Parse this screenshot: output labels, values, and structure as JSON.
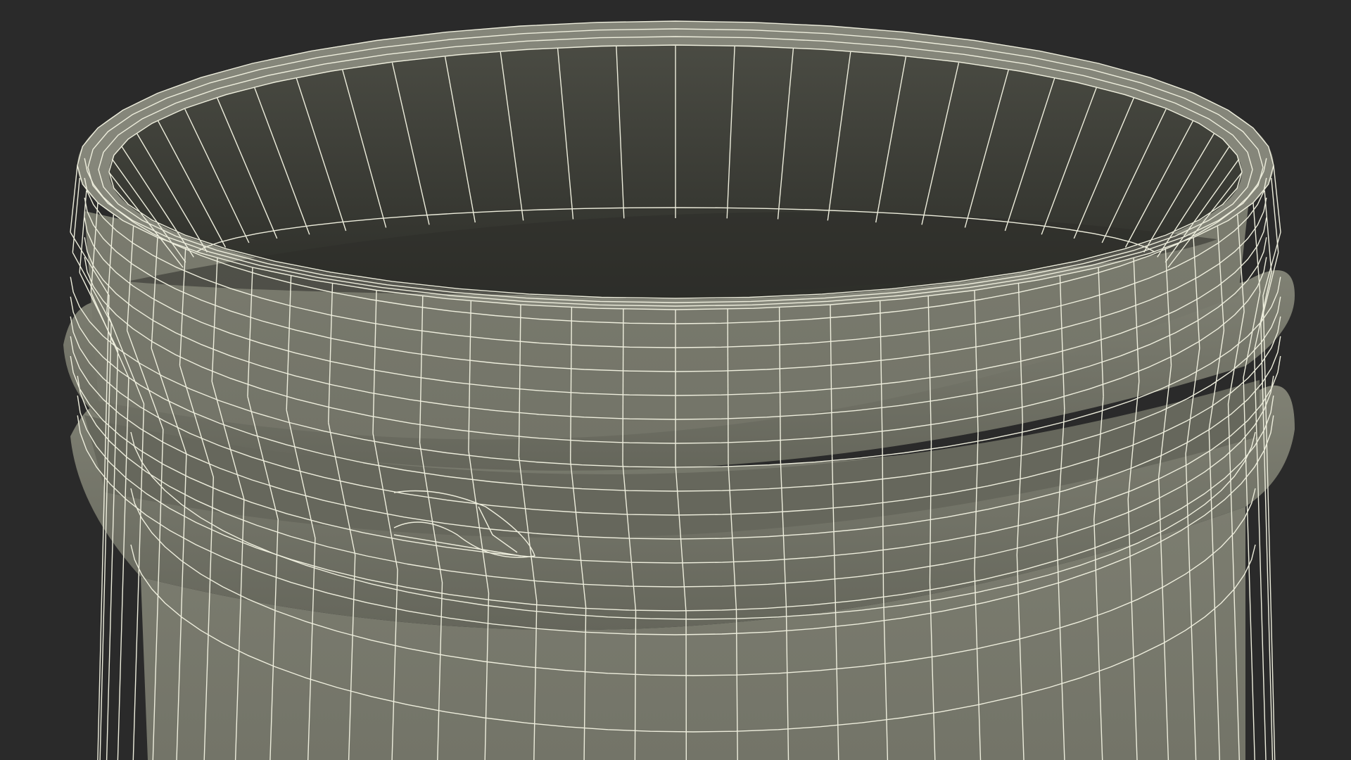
{
  "scene": {
    "subject": "wireframe-jar-neck",
    "colors": {
      "background": "#2a2a2a",
      "surface_outer": "#7a7b6e",
      "surface_outer_shade": "#6a6b60",
      "surface_inner": "#45463f",
      "surface_inner_dark": "#2f302b",
      "wire": "#eeeedd"
    }
  }
}
